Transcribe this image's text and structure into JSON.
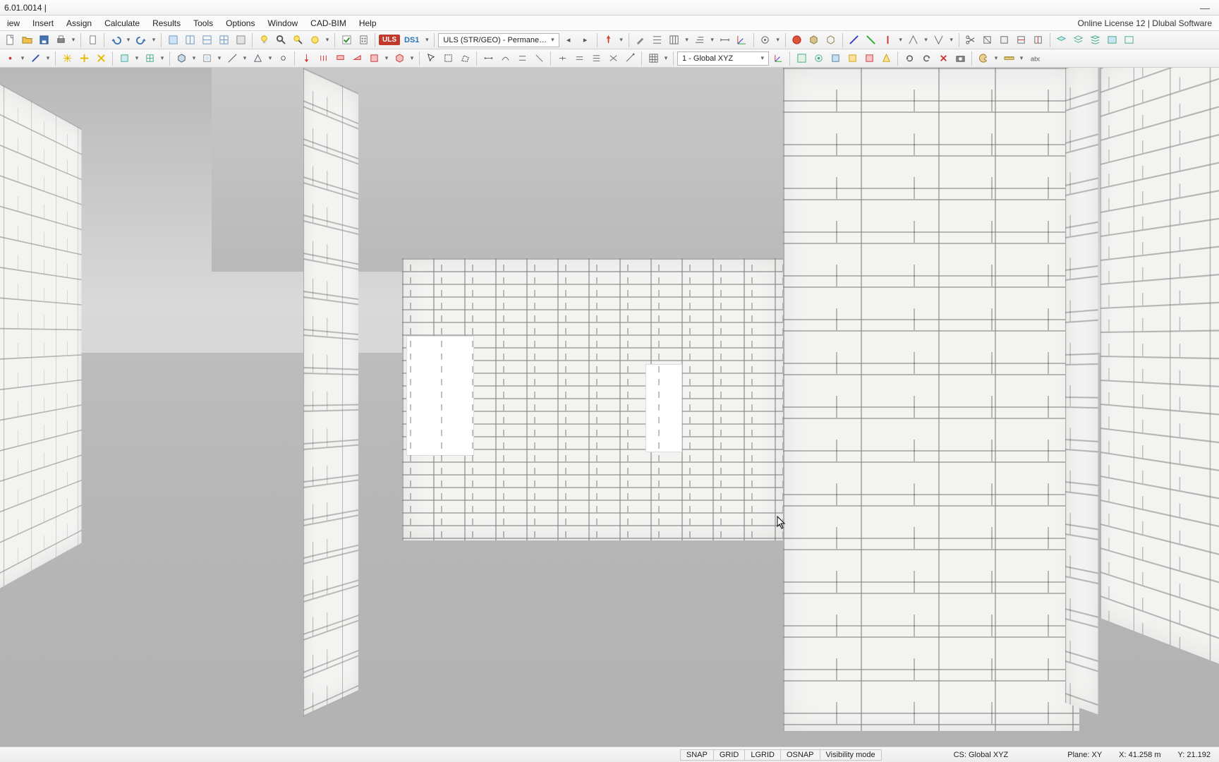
{
  "titlebar": {
    "title": "6.01.0014 |"
  },
  "menubar": {
    "items": [
      "iew",
      "Insert",
      "Assign",
      "Calculate",
      "Results",
      "Tools",
      "Options",
      "Window",
      "CAD-BIM",
      "Help"
    ],
    "right": "Online License 12 | Dlubal Software"
  },
  "toolbar1": {
    "uls_badge": "ULS",
    "ds1_badge": "DS1",
    "design_combo": "ULS (STR/GEO) - Permane…",
    "cs_combo": "1 - Global XYZ"
  },
  "statusbar": {
    "snap": "SNAP",
    "grid": "GRID",
    "lgrid": "LGRID",
    "osnap": "OSNAP",
    "vis": "Visibility mode",
    "cs": "CS: Global XYZ",
    "plane": "Plane: XY",
    "x": "X: 41.258 m",
    "y": "Y: 21.192 "
  },
  "icons": {
    "new": "new-file-icon",
    "open": "open-icon",
    "save": "save-icon",
    "print": "print-icon",
    "clipboard": "clipboard-icon",
    "undo": "undo-icon",
    "redo": "redo-icon",
    "win1": "window-1-icon",
    "win2": "window-2-icon",
    "win3": "window-3-icon",
    "win4": "window-4-icon",
    "win5": "window-5-icon",
    "bulb": "bulb-icon",
    "zoom": "zoom-icon",
    "zoom2": "zoom-extents-icon",
    "zoom3": "zoom-window-icon",
    "check": "check-calc-icon",
    "calc": "calc-icon",
    "pin": "pin-icon",
    "tool1": "tool-icon",
    "tool2": "align-icon",
    "tool3": "grid-icon",
    "tool4": "grid2-icon",
    "tool5": "dim-icon",
    "tool6": "axis-icon",
    "tool7": "target-icon",
    "globe": "globe-icon",
    "cube": "cube-icon",
    "cube2": "cube2-icon",
    "ax1": "axis-x-icon",
    "ax2": "axis-y-icon",
    "ax3": "axis-z-icon",
    "ax4": "axis-xy-icon",
    "ax5": "axis-yz-icon",
    "sc1": "scissor-icon",
    "sc2": "clip-icon",
    "sc3": "clip2-icon",
    "sc4": "section-icon",
    "sc5": "section2-icon",
    "lay1": "layer1-icon",
    "lay2": "layer2-icon",
    "lay3": "layer3-icon",
    "lay4": "layer4-icon",
    "lay5": "layer5-icon",
    "node": "node-icon",
    "member": "member-icon",
    "member2": "member-star-icon",
    "member3": "member-plus-icon",
    "surf": "surface-icon",
    "surf2": "surface-plus-icon",
    "solid": "solid-icon",
    "opening": "opening-icon",
    "line": "line-icon",
    "support": "support-icon",
    "hinge": "hinge-icon",
    "l1": "load1-icon",
    "l2": "load2-icon",
    "l3": "load3-icon",
    "l4": "load4-icon",
    "l5": "load5-icon",
    "l6": "load6-icon",
    "sel": "select-icon",
    "sel2": "select-rect-icon",
    "sel3": "select-poly-icon",
    "e1": "edit1-icon",
    "e2": "edit2-icon",
    "e3": "edit3-icon",
    "e4": "edit4-icon",
    "e5": "edit5-icon",
    "e6": "edit6-icon",
    "e7": "edit7-icon",
    "m1": "mesh-icon",
    "m2": "fe-mesh-icon",
    "csicon": "coordsys-icon",
    "v1": "view1-icon",
    "v2": "view2-icon",
    "v3": "view3-icon",
    "v4": "view4-icon",
    "v5": "view5-icon",
    "v6": "view6-icon",
    "del": "delete-icon",
    "ref": "refresh-icon",
    "ref2": "refresh2-icon",
    "cam": "camera-icon",
    "pal": "palette-icon",
    "meas": "measure-icon",
    "abc": "text-icon"
  }
}
